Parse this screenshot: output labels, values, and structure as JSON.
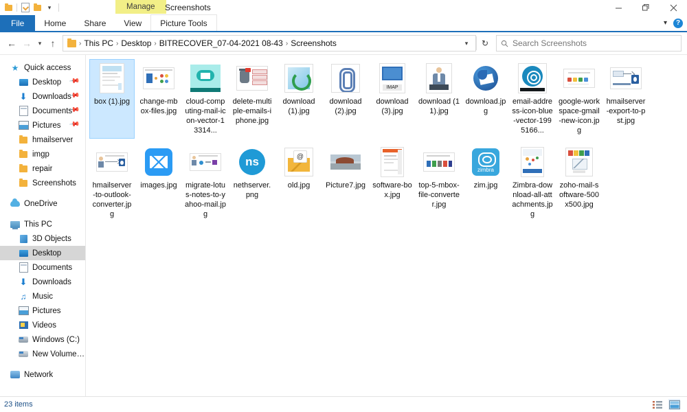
{
  "window": {
    "title": "Screenshots",
    "contextual_tab": "Manage",
    "quick_access_icons": [
      "folder-icon",
      "properties-icon",
      "new-folder-icon",
      "customize-caret-icon"
    ],
    "controls": {
      "minimize": "minimize-button",
      "restore": "restore-button",
      "close": "close-button"
    }
  },
  "ribbon": {
    "tabs": [
      {
        "label": "File",
        "id": "file"
      },
      {
        "label": "Home",
        "id": "home"
      },
      {
        "label": "Share",
        "id": "share"
      },
      {
        "label": "View",
        "id": "view"
      },
      {
        "label": "Picture Tools",
        "id": "picture-tools"
      }
    ],
    "collapse_icon": "chevron-down-icon",
    "help_label": "?"
  },
  "address": {
    "back_icon": "arrow-left-icon",
    "forward_icon": "arrow-right-icon",
    "recent_icon": "chevron-down-icon",
    "up_icon": "arrow-up-icon",
    "breadcrumbs": [
      "This PC",
      "Desktop",
      "BITRECOVER_07-04-2021 08-43",
      "Screenshots"
    ],
    "separator": "›",
    "dropdown_icon": "chevron-down-icon",
    "refresh_icon": "refresh-icon"
  },
  "search": {
    "placeholder": "Search Screenshots",
    "value": "",
    "icon": "search-icon"
  },
  "sidebar": {
    "groups": [
      {
        "header": {
          "label": "Quick access",
          "icon": "star-icon"
        },
        "items": [
          {
            "label": "Desktop",
            "icon": "desktop-icon",
            "pinned": true
          },
          {
            "label": "Downloads",
            "icon": "downloads-icon",
            "pinned": true
          },
          {
            "label": "Documents",
            "icon": "documents-icon",
            "pinned": true
          },
          {
            "label": "Pictures",
            "icon": "pictures-icon",
            "pinned": true
          },
          {
            "label": "hmailserver",
            "icon": "folder-icon",
            "pinned": false
          },
          {
            "label": "imgp",
            "icon": "folder-icon",
            "pinned": false
          },
          {
            "label": "repair",
            "icon": "folder-icon",
            "pinned": false
          },
          {
            "label": "Screenshots",
            "icon": "folder-icon",
            "pinned": false
          }
        ]
      },
      {
        "header": {
          "label": "OneDrive",
          "icon": "onedrive-icon"
        },
        "items": []
      },
      {
        "header": {
          "label": "This PC",
          "icon": "this-pc-icon"
        },
        "items": [
          {
            "label": "3D Objects",
            "icon": "3d-objects-icon",
            "selected": false
          },
          {
            "label": "Desktop",
            "icon": "desktop-icon",
            "selected": true
          },
          {
            "label": "Documents",
            "icon": "documents-icon",
            "selected": false
          },
          {
            "label": "Downloads",
            "icon": "downloads-icon",
            "selected": false
          },
          {
            "label": "Music",
            "icon": "music-icon",
            "selected": false
          },
          {
            "label": "Pictures",
            "icon": "pictures-icon",
            "selected": false
          },
          {
            "label": "Videos",
            "icon": "videos-icon",
            "selected": false
          },
          {
            "label": "Windows (C:)",
            "icon": "drive-icon",
            "selected": false
          },
          {
            "label": "New Volume (D:)",
            "icon": "drive-icon",
            "selected": false
          }
        ]
      },
      {
        "header": {
          "label": "Network",
          "icon": "network-icon"
        },
        "items": []
      }
    ]
  },
  "files": [
    {
      "name": "box (1).jpg",
      "thumb": "box-document",
      "selected": true
    },
    {
      "name": "change-mbox-files.jpg",
      "thumb": "change-mbox",
      "selected": false
    },
    {
      "name": "cloud-computing-mail-icon-vector-13314...",
      "thumb": "cloud-mail",
      "selected": false
    },
    {
      "name": "delete-multiple-emails-iphone.jpg",
      "thumb": "delete-emails",
      "selected": false
    },
    {
      "name": "download (1).jpg",
      "thumb": "recycle-arrows",
      "selected": false
    },
    {
      "name": "download (2).jpg",
      "thumb": "paperclip",
      "selected": false
    },
    {
      "name": "download (3).jpg",
      "thumb": "imap-screen",
      "selected": false
    },
    {
      "name": "download (11).jpg",
      "thumb": "person-suit",
      "selected": false
    },
    {
      "name": "download.jpg",
      "thumb": "thunderbird",
      "selected": false
    },
    {
      "name": "email-address-icon-blue-vector-1995166...",
      "thumb": "at-circle",
      "selected": false
    },
    {
      "name": "google-workspace-gmail-new-icon.jpg",
      "thumb": "gmail-icons-row",
      "selected": false
    },
    {
      "name": "hmailserver-export-to-pst.jpg",
      "thumb": "hmail-export",
      "selected": false
    },
    {
      "name": "hmailserver-to-outlook-converter.jpg",
      "thumb": "hmail-outlook",
      "selected": false
    },
    {
      "name": "images.jpg",
      "thumb": "blue-envelope",
      "selected": false
    },
    {
      "name": "migrate-lotus-notes-to-yahoo-mail.jpg",
      "thumb": "migrate-diagram",
      "selected": false
    },
    {
      "name": "nethserver.png",
      "thumb": "nethserver",
      "selected": false
    },
    {
      "name": "old.jpg",
      "thumb": "at-envelope",
      "selected": false
    },
    {
      "name": "Picture7.jpg",
      "thumb": "landscape-photo",
      "selected": false
    },
    {
      "name": "software-box.jpg",
      "thumb": "software-box",
      "selected": false
    },
    {
      "name": "top-5-mbox-file-converter.jpg",
      "thumb": "top5-icons",
      "selected": false
    },
    {
      "name": "zim.jpg",
      "thumb": "zimbra",
      "selected": false
    },
    {
      "name": "Zimbra-download-all-attachments.jpg",
      "thumb": "zimbra-box",
      "selected": false
    },
    {
      "name": "zoho-mail-software-500x500.jpg",
      "thumb": "zoho-mail",
      "selected": false
    }
  ],
  "statusbar": {
    "item_count": "23 items",
    "views": [
      {
        "id": "details-view",
        "label": "Details view",
        "active": false
      },
      {
        "id": "large-icons-view",
        "label": "Large icons view",
        "active": true
      }
    ]
  }
}
